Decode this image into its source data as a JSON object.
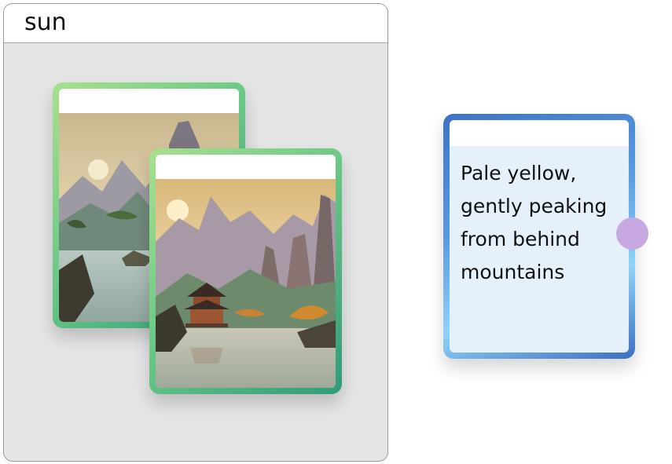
{
  "group": {
    "title": "sun"
  },
  "text_card": {
    "text": "Pale yellow, gently peaking from behind mountains"
  },
  "colors": {
    "image_card_border": "#6cc986",
    "text_card_border": "#5a9ae0",
    "connector": "#c8a8e0",
    "group_background": "#e5e5e5"
  },
  "icons": {
    "connector": "connector-handle-icon"
  }
}
